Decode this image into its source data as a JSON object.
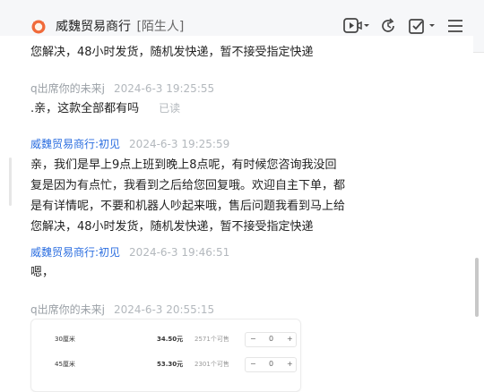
{
  "header": {
    "shop_name": "威魏贸易商行",
    "tag": "[陌生人]",
    "icons": [
      "video-call-icon",
      "refresh-icon",
      "checklist-icon",
      "menu-icon"
    ]
  },
  "messages": [
    {
      "type": "text",
      "text": "您解决，48小时发货，随机发快递，暂不接受指定快递"
    },
    {
      "type": "meta",
      "sender": "q出席你的未来j",
      "time": "2024-6-3 19:25:55"
    },
    {
      "type": "text",
      "text": ".亲，这款全部都有吗",
      "status": "已读"
    },
    {
      "type": "meta",
      "sender": "威魏贸易商行:初见",
      "time": "2024-6-3 19:25:59"
    },
    {
      "type": "text",
      "lines": [
        "亲，我们是早上9点上班到晚上8点呢，有时候您咨询我没回",
        "复是因为有点忙，我看到之后给您回复哦。欢迎自主下单，都",
        "是有详情呢，不要和机器人吵起来哦，售后问题我看到马上给",
        "您解决，48小时发货，随机发快递，暂不接受指定快递"
      ]
    },
    {
      "type": "meta",
      "sender": "威魏贸易商行:初见",
      "time": "2024-6-3 19:46:51"
    },
    {
      "type": "text",
      "text": "嗯，"
    },
    {
      "type": "meta",
      "sender": "q出席你的未来j",
      "time": "2024-6-3 20:55:15"
    }
  ],
  "product_card": {
    "rows": [
      {
        "name": "30厘米",
        "price": "34.50元",
        "stock": "2571个可售",
        "minus": "−",
        "qty": "0",
        "plus": "+"
      },
      {
        "name": "45厘米",
        "price": "53.30元",
        "stock": "2301个可售",
        "minus": "−",
        "qty": "0",
        "plus": "+"
      }
    ]
  },
  "colors": {
    "shop_sender": "#2b6ee0",
    "customer_sender": "#9aa0a6",
    "header_bg": "#f6f7f9"
  }
}
